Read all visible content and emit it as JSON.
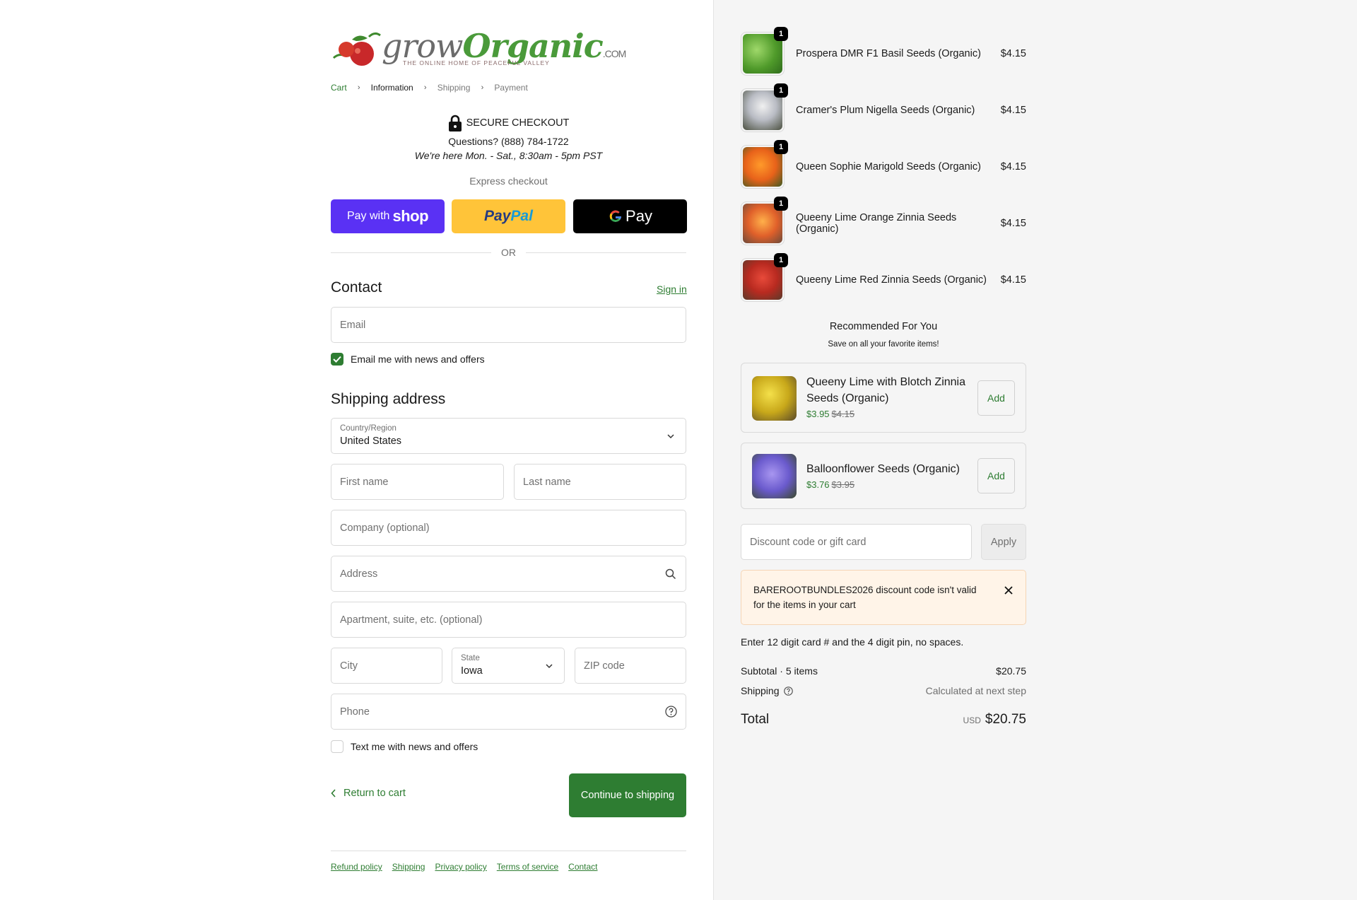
{
  "brand": {
    "grow": "grow",
    "organic": "Organic",
    "com": ".COM",
    "tagline": "THE ONLINE HOME OF PEACEFUL VALLEY",
    "accent": "#2e7d32"
  },
  "breadcrumb": [
    "Cart",
    "Information",
    "Shipping",
    "Payment"
  ],
  "secure": {
    "title": "SECURE CHECKOUT",
    "phone": "Questions? (888) 784-1722",
    "hours": "We're here Mon. - Sat., 8:30am - 5pm PST"
  },
  "express": {
    "label": "Express checkout",
    "shop_prefix": "Pay with",
    "shop_brand": "shop",
    "paypal_a": "Pay",
    "paypal_b": "Pal",
    "gpay": "Pay",
    "or": "OR"
  },
  "contact": {
    "heading": "Contact",
    "signin": "Sign in",
    "email_placeholder": "Email",
    "news_label": "Email me with news and offers",
    "news_checked": true
  },
  "shipping": {
    "heading": "Shipping address",
    "country_label": "Country/Region",
    "country_value": "United States",
    "first_name": "First name",
    "last_name": "Last name",
    "company": "Company (optional)",
    "address": "Address",
    "apartment": "Apartment, suite, etc. (optional)",
    "city": "City",
    "state_label": "State",
    "state_value": "Iowa",
    "zip": "ZIP code",
    "phone": "Phone",
    "text_label": "Text me with news and offers",
    "text_checked": false
  },
  "actions": {
    "return": "Return to cart",
    "continue": "Continue to shipping"
  },
  "footer": [
    "Refund policy",
    "Shipping",
    "Privacy policy",
    "Terms of service",
    "Contact"
  ],
  "cart": [
    {
      "name": "Prospera DMR F1 Basil Seeds (Organic)",
      "price": "$4.15",
      "qty": "1"
    },
    {
      "name": "Cramer's Plum Nigella Seeds (Organic)",
      "price": "$4.15",
      "qty": "1"
    },
    {
      "name": "Queen Sophie Marigold Seeds (Organic)",
      "price": "$4.15",
      "qty": "1"
    },
    {
      "name": "Queeny Lime Orange Zinnia Seeds (Organic)",
      "price": "$4.15",
      "qty": "1"
    },
    {
      "name": "Queeny Lime Red Zinnia Seeds (Organic)",
      "price": "$4.15",
      "qty": "1"
    }
  ],
  "recommended": {
    "title": "Recommended For You",
    "subtitle": "Save on all your favorite items!",
    "items": [
      {
        "name": "Queeny Lime with Blotch Zinnia Seeds (Organic)",
        "price": "$3.95",
        "was": "$4.15",
        "add": "Add"
      },
      {
        "name": "Balloonflower Seeds (Organic)",
        "price": "$3.76",
        "was": "$3.95",
        "add": "Add"
      }
    ]
  },
  "discount": {
    "placeholder": "Discount code or gift card",
    "apply": "Apply",
    "error": "BAREROOTBUNDLES2026 discount code isn't valid for the items in your cart",
    "hint": "Enter 12 digit card # and the 4 digit pin, no spaces."
  },
  "summary": {
    "subtotal_label": "Subtotal · 5 items",
    "subtotal": "$20.75",
    "shipping_label": "Shipping",
    "shipping_value": "Calculated at next step",
    "total_label": "Total",
    "currency": "USD",
    "total": "$20.75"
  }
}
